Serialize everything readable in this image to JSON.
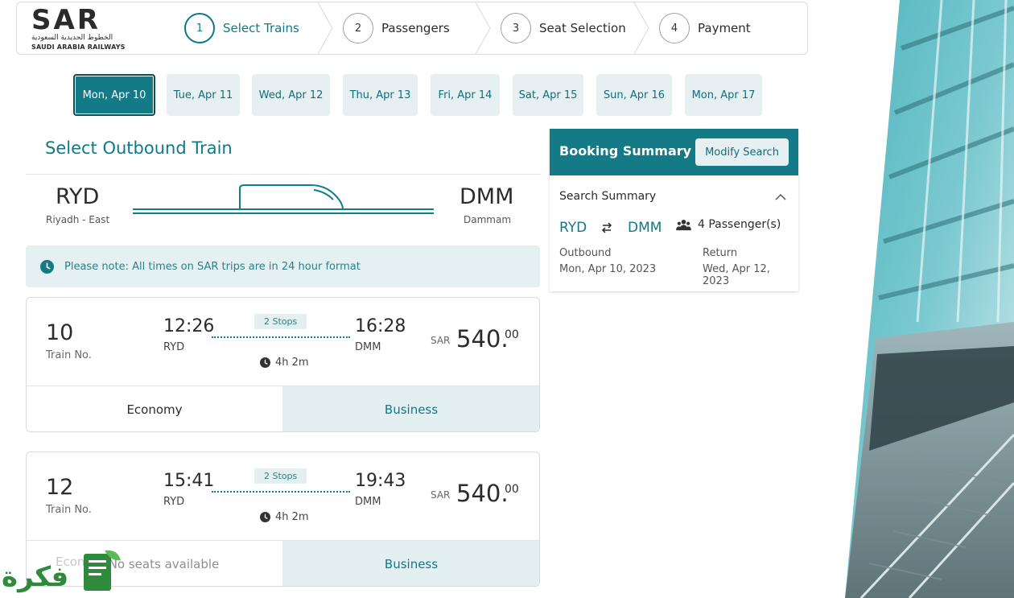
{
  "brand": {
    "name": "SAR",
    "arabic_name": "الخطوط الحديدية السعودية",
    "english_name": "SAUDI ARABIA RAILWAYS"
  },
  "steps": [
    {
      "num": "1",
      "label": "Select Trains",
      "active": true
    },
    {
      "num": "2",
      "label": "Passengers",
      "active": false
    },
    {
      "num": "3",
      "label": "Seat Selection",
      "active": false
    },
    {
      "num": "4",
      "label": "Payment",
      "active": false
    }
  ],
  "dates": [
    {
      "label": "Mon, Apr 10",
      "active": true
    },
    {
      "label": "Tue, Apr 11",
      "active": false
    },
    {
      "label": "Wed, Apr 12",
      "active": false
    },
    {
      "label": "Thu, Apr 13",
      "active": false
    },
    {
      "label": "Fri, Apr 14",
      "active": false
    },
    {
      "label": "Sat, Apr 15",
      "active": false
    },
    {
      "label": "Sun, Apr 16",
      "active": false
    },
    {
      "label": "Mon, Apr 17",
      "active": false
    }
  ],
  "outbound": {
    "title": "Select Outbound Train",
    "origin_code": "RYD",
    "origin_name": "Riyadh - East",
    "dest_code": "DMM",
    "dest_name": "Dammam",
    "note": "Please note: All times on SAR trips are in 24 hour format"
  },
  "trains": [
    {
      "number": "10",
      "number_label": "Train No.",
      "depart": "12:26",
      "depart_station": "RYD",
      "arrive": "16:28",
      "arrive_station": "DMM",
      "stops": "2 Stops",
      "duration": "4h 2m",
      "currency": "SAR",
      "price": "540.",
      "price_decimal": "00",
      "economy": "Economy",
      "business": "Business"
    },
    {
      "number": "12",
      "number_label": "Train No.",
      "depart": "15:41",
      "depart_station": "RYD",
      "arrive": "19:43",
      "arrive_station": "DMM",
      "stops": "2 Stops",
      "duration": "4h 2m",
      "currency": "SAR",
      "price": "540.",
      "price_decimal": "00",
      "economy": "Econ",
      "economy_status": "No seats available",
      "business": "Business"
    }
  ],
  "summary": {
    "title": "Booking Summary",
    "modify": "Modify Search",
    "search_summary": "Search Summary",
    "from": "RYD",
    "to": "DMM",
    "passengers": "4 Passenger(s)",
    "outbound_label": "Outbound",
    "outbound_date": "Mon, Apr 10, 2023",
    "return_label": "Return",
    "return_date": "Wed, Apr 12, 2023"
  },
  "watermark": "فكرة",
  "colors": {
    "accent": "#137a86",
    "accent_light": "#e3eff1",
    "text": "#2b2b2b"
  },
  "icons": [
    "clock-icon",
    "swap-icon",
    "passengers-icon",
    "chevron-up-icon",
    "no-entry-icon",
    "train-icon"
  ]
}
